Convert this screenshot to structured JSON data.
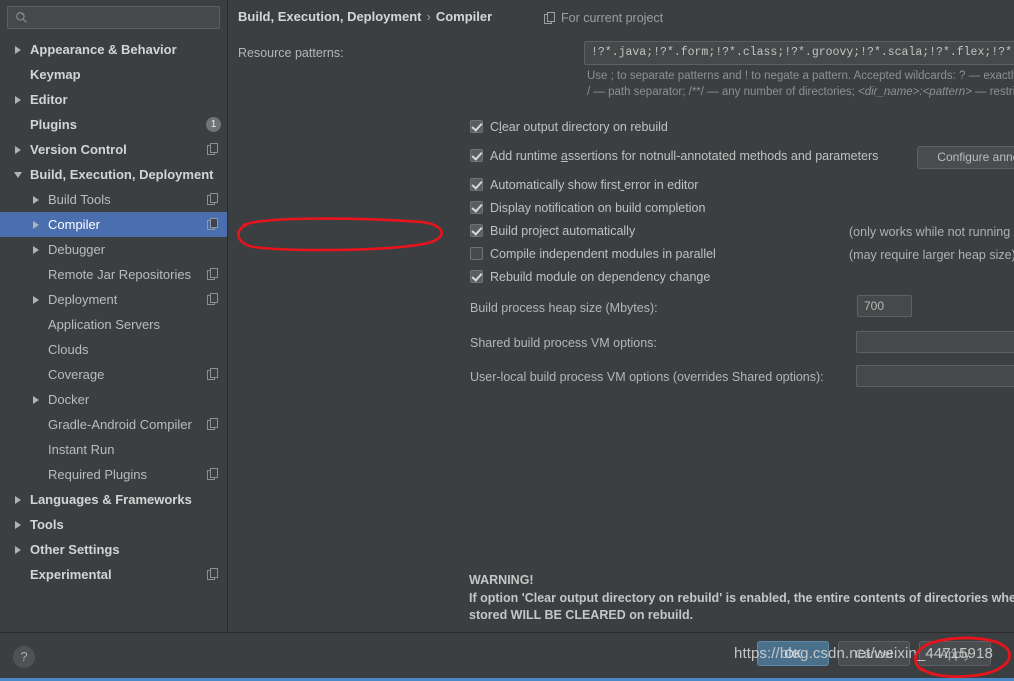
{
  "window": {
    "accent": "#4b6eaf",
    "background": "#3c3f41",
    "annotation_color": "#e8131b"
  },
  "search": {
    "value": "",
    "placeholder": ""
  },
  "sidebar": {
    "items": [
      {
        "label": "Appearance & Behavior",
        "level": 0,
        "arrow": "collapsed",
        "bold": true,
        "selected": false,
        "copy_icon": false,
        "badge": null
      },
      {
        "label": "Keymap",
        "level": 0,
        "arrow": "none",
        "bold": true,
        "selected": false,
        "copy_icon": false,
        "badge": null
      },
      {
        "label": "Editor",
        "level": 0,
        "arrow": "collapsed",
        "bold": true,
        "selected": false,
        "copy_icon": false,
        "badge": null
      },
      {
        "label": "Plugins",
        "level": 0,
        "arrow": "none",
        "bold": true,
        "selected": false,
        "copy_icon": false,
        "badge": "1"
      },
      {
        "label": "Version Control",
        "level": 0,
        "arrow": "collapsed",
        "bold": true,
        "selected": false,
        "copy_icon": true,
        "badge": null
      },
      {
        "label": "Build, Execution, Deployment",
        "level": 0,
        "arrow": "expanded",
        "bold": true,
        "selected": false,
        "copy_icon": false,
        "badge": null
      },
      {
        "label": "Build Tools",
        "level": 1,
        "arrow": "collapsed",
        "bold": false,
        "selected": false,
        "copy_icon": true,
        "badge": null
      },
      {
        "label": "Compiler",
        "level": 1,
        "arrow": "collapsed",
        "bold": false,
        "selected": true,
        "copy_icon": true,
        "badge": null
      },
      {
        "label": "Debugger",
        "level": 1,
        "arrow": "collapsed",
        "bold": false,
        "selected": false,
        "copy_icon": false,
        "badge": null
      },
      {
        "label": "Remote Jar Repositories",
        "level": 1,
        "arrow": "none",
        "bold": false,
        "selected": false,
        "copy_icon": true,
        "badge": null
      },
      {
        "label": "Deployment",
        "level": 1,
        "arrow": "collapsed",
        "bold": false,
        "selected": false,
        "copy_icon": true,
        "badge": null
      },
      {
        "label": "Application Servers",
        "level": 1,
        "arrow": "none",
        "bold": false,
        "selected": false,
        "copy_icon": false,
        "badge": null
      },
      {
        "label": "Clouds",
        "level": 1,
        "arrow": "none",
        "bold": false,
        "selected": false,
        "copy_icon": false,
        "badge": null
      },
      {
        "label": "Coverage",
        "level": 1,
        "arrow": "none",
        "bold": false,
        "selected": false,
        "copy_icon": true,
        "badge": null
      },
      {
        "label": "Docker",
        "level": 1,
        "arrow": "collapsed",
        "bold": false,
        "selected": false,
        "copy_icon": false,
        "badge": null
      },
      {
        "label": "Gradle-Android Compiler",
        "level": 1,
        "arrow": "none",
        "bold": false,
        "selected": false,
        "copy_icon": true,
        "badge": null
      },
      {
        "label": "Instant Run",
        "level": 1,
        "arrow": "none",
        "bold": false,
        "selected": false,
        "copy_icon": false,
        "badge": null
      },
      {
        "label": "Required Plugins",
        "level": 1,
        "arrow": "none",
        "bold": false,
        "selected": false,
        "copy_icon": true,
        "badge": null
      },
      {
        "label": "Languages & Frameworks",
        "level": 0,
        "arrow": "collapsed",
        "bold": true,
        "selected": false,
        "copy_icon": false,
        "badge": null
      },
      {
        "label": "Tools",
        "level": 0,
        "arrow": "collapsed",
        "bold": true,
        "selected": false,
        "copy_icon": false,
        "badge": null
      },
      {
        "label": "Other Settings",
        "level": 0,
        "arrow": "collapsed",
        "bold": true,
        "selected": false,
        "copy_icon": false,
        "badge": null
      },
      {
        "label": "Experimental",
        "level": 0,
        "arrow": "none",
        "bold": true,
        "selected": false,
        "copy_icon": true,
        "badge": null
      }
    ]
  },
  "header": {
    "breadcrumb_root": "Build, Execution, Deployment",
    "breadcrumb_separator": "›",
    "breadcrumb_leaf": "Compiler",
    "scope_label": "For current project"
  },
  "resource_patterns": {
    "label": "Resource patterns:",
    "value": "!?*.java;!?*.form;!?*.class;!?*.groovy;!?*.scala;!?*.flex;!?*.kt;!?*.clj;!?*.aj",
    "hint_part1": "Use ; to separate patterns and ! to negate a pattern. Accepted wildcards: ? — exactly one symbol; * — zero or more symbols; / — path separator; /**/ — any number of directories; ",
    "hint_italic": "<dir_name>:<pattern>",
    "hint_part2": " — restrict to source roots with the specified name"
  },
  "options": [
    {
      "label": "Clear output directory on rebuild",
      "checked": true,
      "note": "",
      "mnemonic_index": 1
    },
    {
      "label": "Add runtime assertions for notnull-annotated methods and parameters",
      "checked": true,
      "note": "",
      "mnemonic_index": 12
    },
    {
      "label": "Automatically show first error in editor",
      "checked": true,
      "note": "",
      "mnemonic_index": 24
    },
    {
      "label": "Display notification on build completion",
      "checked": true,
      "note": "",
      "mnemonic_index": -1
    },
    {
      "label": "Build project automatically",
      "checked": true,
      "note": "(only works while not running / debugging)",
      "mnemonic_index": -1
    },
    {
      "label": "Compile independent modules in parallel",
      "checked": false,
      "note": "(may require larger heap size)",
      "mnemonic_index": -1
    },
    {
      "label": "Rebuild module on dependency change",
      "checked": true,
      "note": "",
      "mnemonic_index": -1
    }
  ],
  "configure_annotations_button": "Configure annotations...",
  "fields": {
    "heap_label": "Build process heap size (Mbytes):",
    "heap_value": "700",
    "shared_vm_label": "Shared build process VM options:",
    "shared_vm_value": "",
    "userlocal_vm_label": "User-local build process VM options (overrides Shared options):",
    "userlocal_vm_value": ""
  },
  "warning": {
    "title": "WARNING!",
    "line1": "If option 'Clear output directory on rebuild' is enabled, the entire contents of directories where generated sources are",
    "line2": "stored WILL BE CLEARED on rebuild."
  },
  "footer": {
    "help_label": "?",
    "ok_label": "OK",
    "cancel_label": "Cancel",
    "apply_label": "Apply"
  },
  "watermark": "https://blog.csdn.net/weixin_44715918"
}
